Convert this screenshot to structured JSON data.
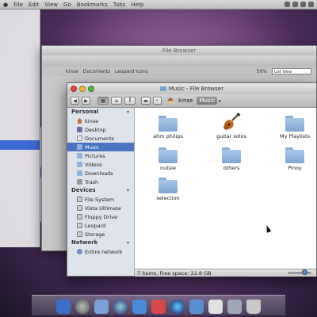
{
  "menubar": {
    "items": [
      "File",
      "Edit",
      "View",
      "Go",
      "Bookmarks",
      "Tabs",
      "Help"
    ]
  },
  "bg_window": {
    "title": "File Browser",
    "address": [
      "kinse",
      "Documents",
      "Leopard Icons"
    ],
    "zoom": "50%",
    "view_mode": "List View"
  },
  "window": {
    "title": "Music - File Browser",
    "breadcrumb": [
      "kinse",
      "Music"
    ]
  },
  "sidebar": {
    "personal_title": "Personal",
    "personal": [
      {
        "label": "kinse",
        "icon": "home-icon"
      },
      {
        "label": "Desktop",
        "icon": "desktop-icon"
      },
      {
        "label": "Documents",
        "icon": "documents-icon"
      },
      {
        "label": "Music",
        "icon": "music-folder-icon"
      },
      {
        "label": "Pictures",
        "icon": "folder-icon"
      },
      {
        "label": "Videos",
        "icon": "folder-icon"
      },
      {
        "label": "Downloads",
        "icon": "folder-icon"
      },
      {
        "label": "Trash",
        "icon": "trash-icon"
      }
    ],
    "devices_title": "Devices",
    "devices": [
      {
        "label": "File System",
        "icon": "drive-icon"
      },
      {
        "label": "Vista Ultimate",
        "icon": "drive-icon"
      },
      {
        "label": "Floppy Drive",
        "icon": "drive-icon"
      },
      {
        "label": "Leopard",
        "icon": "drive-icon"
      },
      {
        "label": "Storage",
        "icon": "drive-icon"
      }
    ],
    "network_title": "Network",
    "network": [
      {
        "label": "Entire network",
        "icon": "network-icon"
      }
    ]
  },
  "files": [
    {
      "name": "ahm philips",
      "icon": "folder-icon"
    },
    {
      "name": "guitar solos",
      "icon": "guitar-icon"
    },
    {
      "name": "My Playlists",
      "icon": "folder-icon"
    },
    {
      "name": "nutsie",
      "icon": "folder-icon"
    },
    {
      "name": "others",
      "icon": "folder-icon"
    },
    {
      "name": "Pinoy",
      "icon": "folder-icon"
    },
    {
      "name": "selection",
      "icon": "folder-icon"
    }
  ],
  "status": {
    "text": "7 items, Free space: 22.8 GB"
  },
  "colors": {
    "selection": "#4a73c2",
    "folder": "#8fb3dc"
  }
}
